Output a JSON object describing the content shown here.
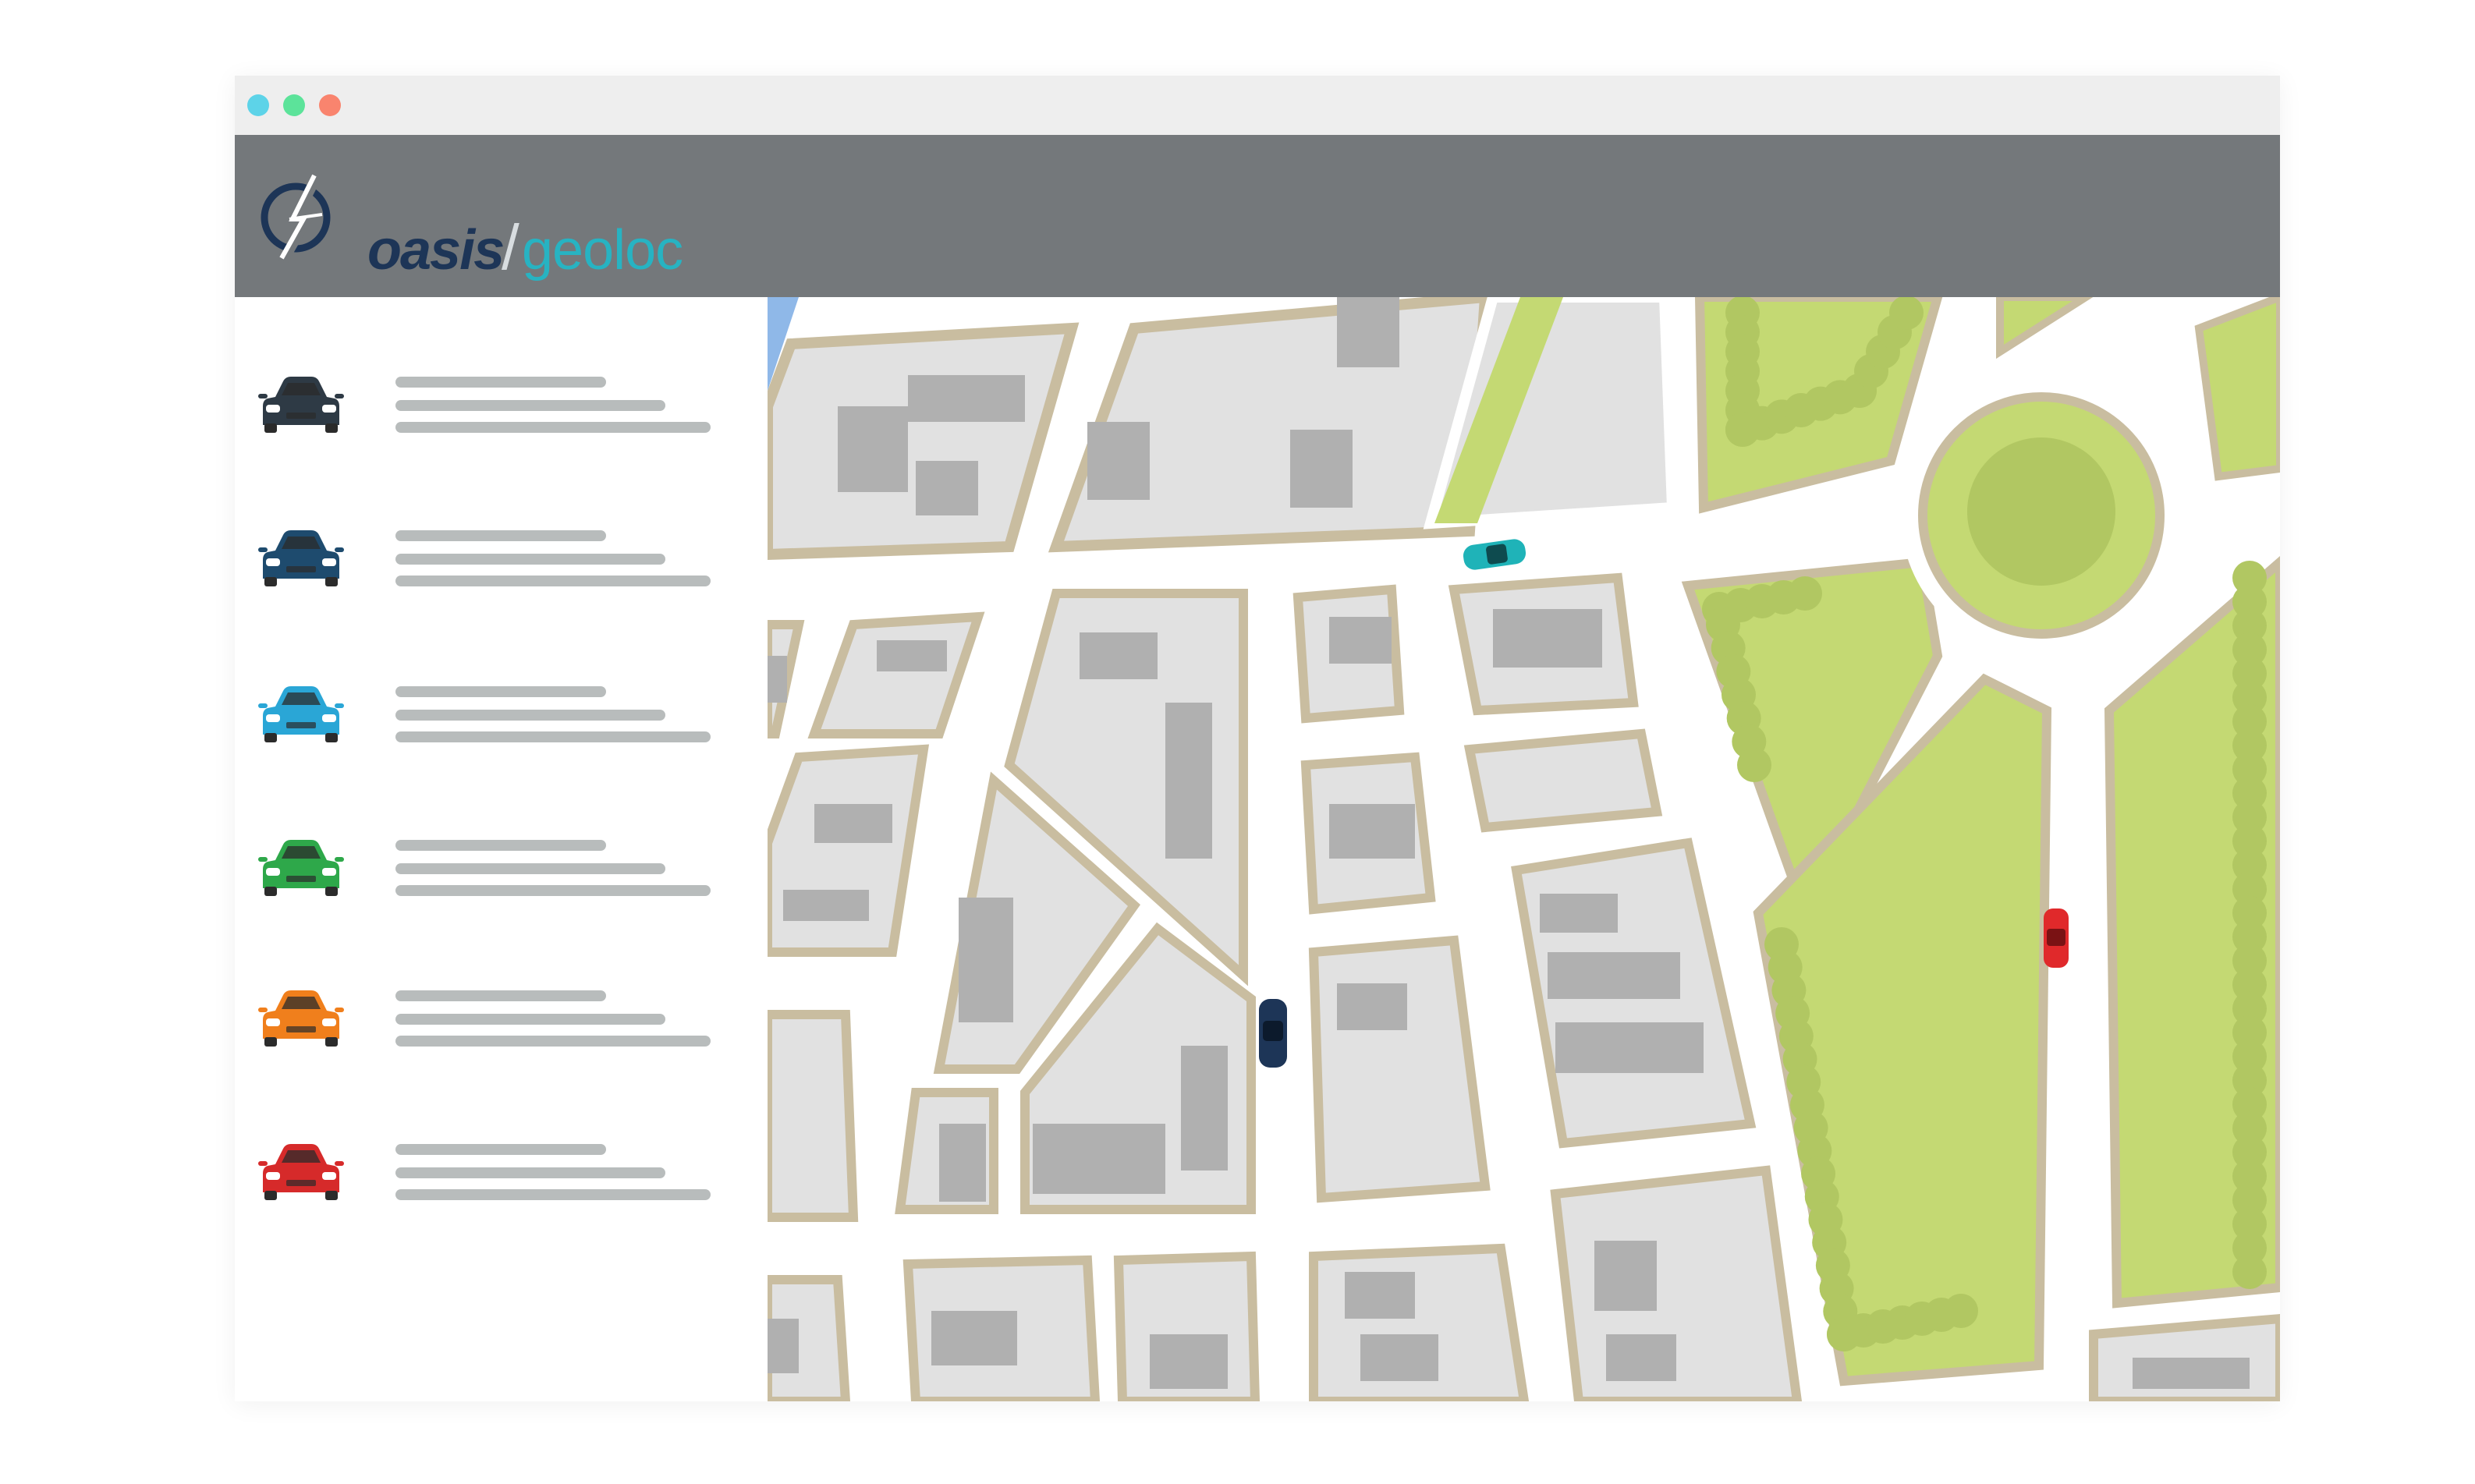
{
  "window": {
    "controls": [
      {
        "name": "minimize",
        "color": "#5dd3e8"
      },
      {
        "name": "maximize",
        "color": "#5ce39a"
      },
      {
        "name": "close",
        "color": "#f9846e"
      }
    ]
  },
  "header": {
    "logo": {
      "brand": "oasis",
      "product": "geoloc",
      "separator": "/"
    },
    "background": "#74787b"
  },
  "sidebar": {
    "vehicles": [
      {
        "color": "#2e3a45",
        "icon": "car-front-icon"
      },
      {
        "color": "#1e4b6e",
        "icon": "car-front-icon"
      },
      {
        "color": "#2aa6d6",
        "icon": "car-front-icon"
      },
      {
        "color": "#2ea84a",
        "icon": "car-front-icon"
      },
      {
        "color": "#f07f1c",
        "icon": "car-front-icon"
      },
      {
        "color": "#d62a2a",
        "icon": "car-front-icon"
      }
    ]
  },
  "map": {
    "vehicles_on_map": [
      {
        "color": "#1fb3b8"
      },
      {
        "color": "#1d3557"
      },
      {
        "color": "#e0292b"
      }
    ],
    "colors": {
      "road": "#ffffff",
      "block": "#e1e1e1",
      "block_border": "#c9bda0",
      "building": "#b0b0b0",
      "park": "#c4d973",
      "tree": "#b1c762",
      "water": "#8fb8e8"
    }
  }
}
